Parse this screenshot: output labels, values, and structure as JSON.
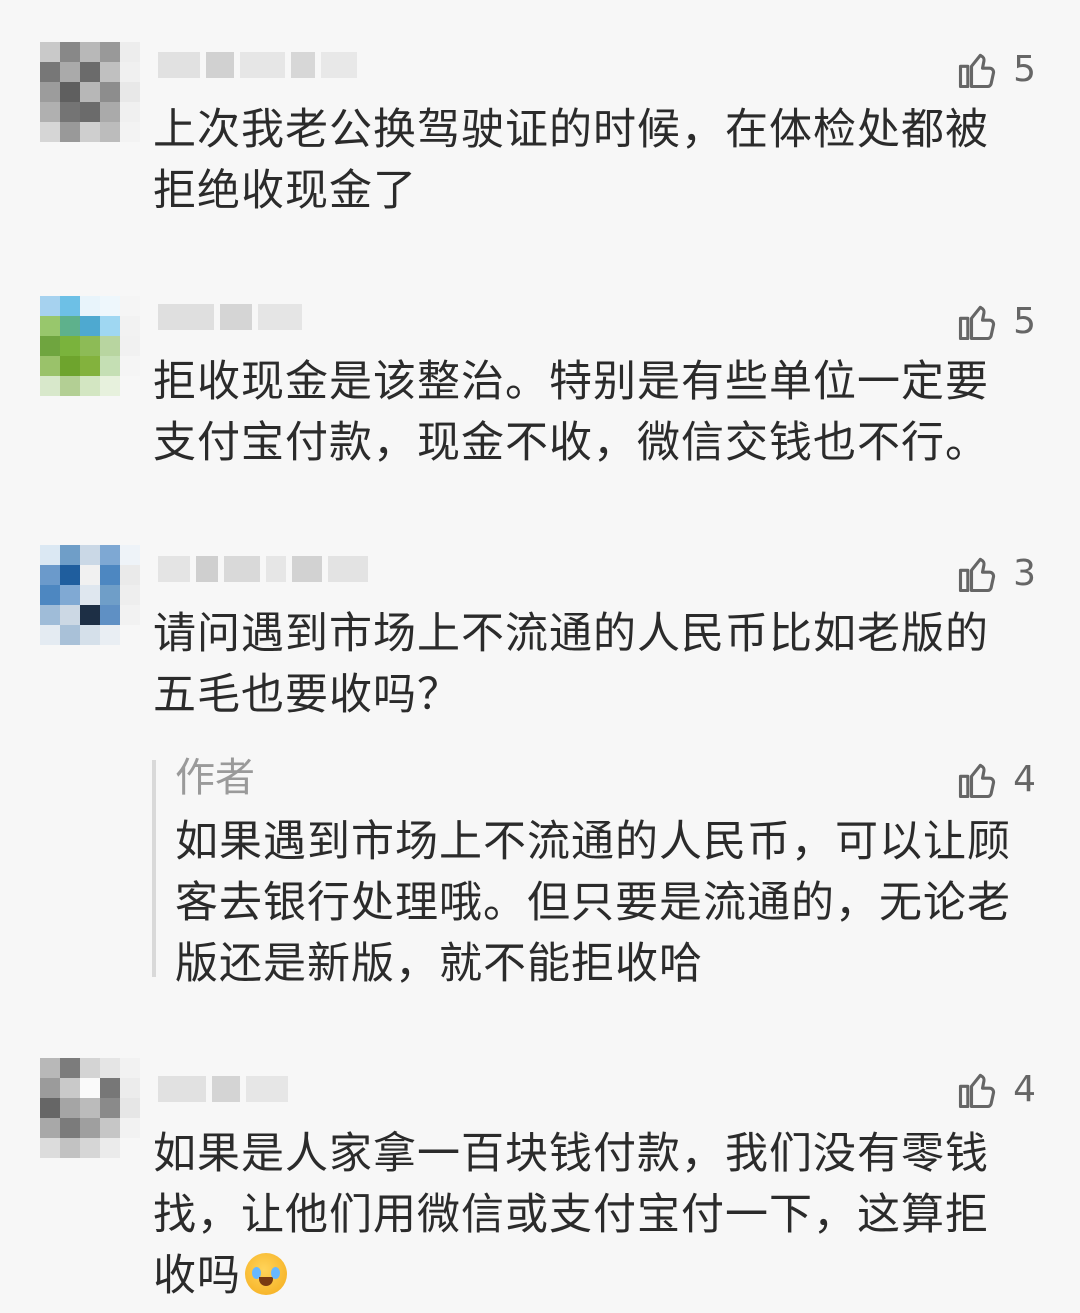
{
  "comments": [
    {
      "likes": "5",
      "lines": [
        "上次我老公换驾驶证的时候，在体检处都被",
        "拒绝收现金了"
      ]
    },
    {
      "likes": "5",
      "lines": [
        "拒收现金是该整治。特别是有些单位一定要",
        "支付宝付款，现金不收，微信交钱也不行。"
      ]
    },
    {
      "likes": "3",
      "lines": [
        "请问遇到市场上不流通的人民币比如老版的",
        "五毛也要收吗？"
      ],
      "reply": {
        "author": "作者",
        "likes": "4",
        "lines": [
          "如果遇到市场上不流通的人民币，可以让顾",
          "客去银行处理哦。但只要是流通的，无论老",
          "版还是新版，就不能拒收哈"
        ]
      }
    },
    {
      "likes": "4",
      "lines": [
        "如果是人家拿一百块钱付款，我们没有零钱",
        "找，让他们用微信或支付宝付一下，这算拒",
        "收吗"
      ]
    }
  ],
  "icons": {
    "like": "thumbs-up-icon",
    "emoji": "crying-laughing-emoji-icon"
  },
  "colors": {
    "background": "#f7f7f7",
    "text": "#2b2b2b",
    "muted": "#9a9a9a"
  }
}
